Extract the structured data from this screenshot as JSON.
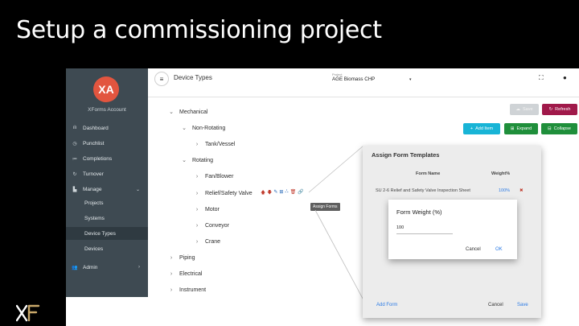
{
  "slide": {
    "title": "Setup a commissioning project"
  },
  "sidebar": {
    "avatar": "XA",
    "account": "XForms Account",
    "items": [
      {
        "icon": "ılı",
        "label": "Dashboard"
      },
      {
        "icon": "◷",
        "label": "Punchlist"
      },
      {
        "icon": "≔",
        "label": "Completions"
      },
      {
        "icon": "↻",
        "label": "Turnover"
      },
      {
        "icon": "▙",
        "label": "Manage",
        "caret": "⌄"
      }
    ],
    "subitems": [
      "Projects",
      "Systems",
      "Device Types",
      "Devices"
    ],
    "admin": {
      "icon": "👥",
      "label": "Admin",
      "caret": "›"
    }
  },
  "topbar": {
    "menu_icon": "≡",
    "title": "Device Types",
    "project_label": "Project",
    "project_value": "AGE Biomass CHP",
    "project_caret": "▾",
    "fullscreen_icon": "⛶",
    "account_icon": "●"
  },
  "toolbar": {
    "save": "Save",
    "save_icon": "☁",
    "refresh": "Refresh",
    "refresh_icon": "↻",
    "add_item": "Add Item",
    "add_icon": "+",
    "expand": "Expand",
    "expand_icon": "⊞",
    "collapse": "Collapse",
    "collapse_icon": "⊟"
  },
  "tree": [
    {
      "chevron": "⌄",
      "label": "Mechanical"
    },
    {
      "chevron": "⌄",
      "label": "Non-Rotating"
    },
    {
      "chevron": "›",
      "label": "Tank/Vessel"
    },
    {
      "chevron": "⌄",
      "label": "Rotating"
    },
    {
      "chevron": "›",
      "label": "Fan/Blower"
    },
    {
      "chevron": "›",
      "label": "Relief/Safety Valve"
    },
    {
      "chevron": "›",
      "label": "Motor"
    },
    {
      "chevron": "›",
      "label": "Conveyor"
    },
    {
      "chevron": "›",
      "label": "Crane"
    },
    {
      "chevron": "›",
      "label": "Piping"
    },
    {
      "chevron": "›",
      "label": "Electrical"
    },
    {
      "chevron": "›",
      "label": "Instrument"
    }
  ],
  "row_actions": {
    "up": "🡅",
    "down": "🡇",
    "edit": "✎",
    "add": "⊞",
    "hierarchy": "⛬",
    "delete": "🗑",
    "assign": "🔗"
  },
  "tooltip": "Assign Forms",
  "assign_modal": {
    "title": "Assign Form Templates",
    "col_form": "Form Name",
    "col_weight": "Weight%",
    "row_form": "SU 2-6 Relief and Safety Valve Inspection Sheet",
    "row_weight": "100%",
    "row_remove": "✖",
    "add_form": "Add Form",
    "cancel": "Cancel",
    "save": "Save"
  },
  "weight_dialog": {
    "title": "Form Weight (%)",
    "value": "100",
    "cancel": "Cancel",
    "ok": "OK"
  },
  "logo": "XF"
}
